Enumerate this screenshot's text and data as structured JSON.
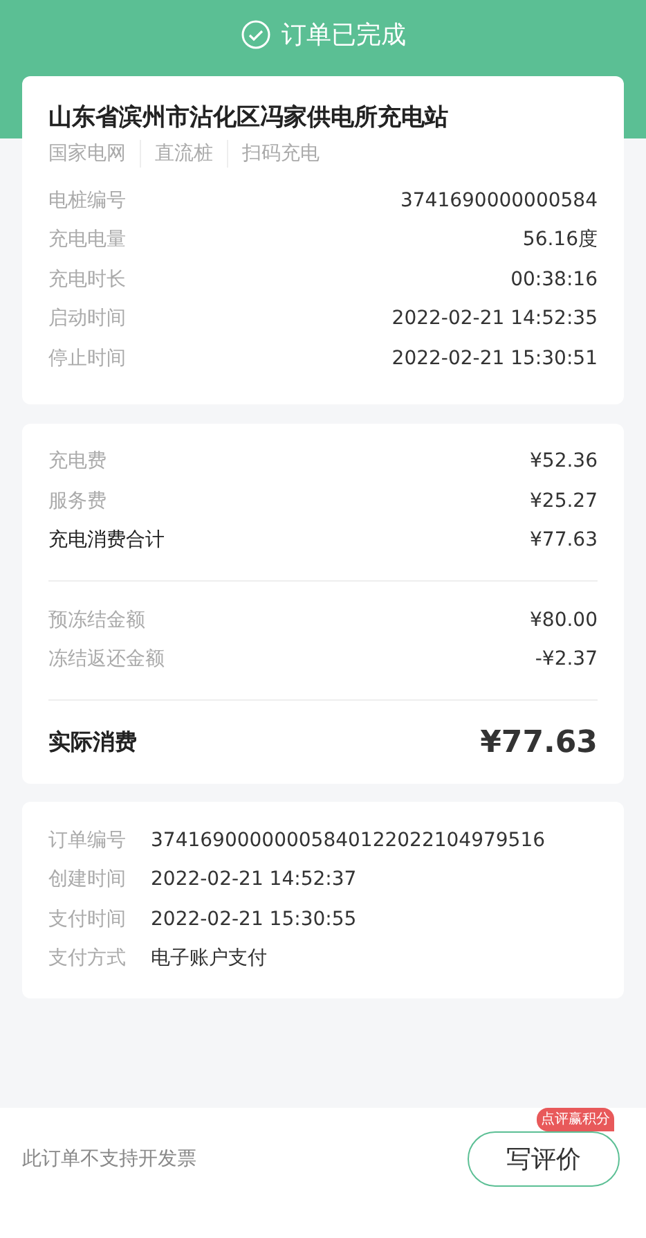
{
  "header": {
    "title": "订单已完成"
  },
  "station": {
    "name": "山东省滨州市沾化区冯家供电所充电站",
    "tags": [
      "国家电网",
      "直流桩",
      "扫码充电"
    ],
    "details": [
      {
        "label": "电桩编号",
        "value": "3741690000000584"
      },
      {
        "label": "充电电量",
        "value": "56.16度"
      },
      {
        "label": "充电时长",
        "value": "00:38:16"
      },
      {
        "label": "启动时间",
        "value": "2022-02-21 14:52:35"
      },
      {
        "label": "停止时间",
        "value": "2022-02-21 15:30:51"
      }
    ]
  },
  "fees": {
    "groups": [
      [
        {
          "kind": "item",
          "label": "充电费",
          "value": "¥52.36"
        },
        {
          "kind": "item",
          "label": "服务费",
          "value": "¥25.27"
        },
        {
          "kind": "subtotal",
          "label": "充电消费合计",
          "value": "¥77.63"
        }
      ],
      [
        {
          "kind": "item",
          "label": "预冻结金额",
          "value": "¥80.00"
        },
        {
          "kind": "item",
          "label": "冻结返还金额",
          "value": "-¥2.37"
        }
      ],
      [
        {
          "kind": "total",
          "label": "实际消费",
          "value": "¥77.63"
        }
      ]
    ]
  },
  "order": [
    {
      "label": "订单编号",
      "value": "37416900000005840122022104979516"
    },
    {
      "label": "创建时间",
      "value": "2022-02-21 14:52:37"
    },
    {
      "label": "支付时间",
      "value": "2022-02-21 15:30:55"
    },
    {
      "label": "支付方式",
      "value": "电子账户支付"
    }
  ],
  "footer": {
    "note": "此订单不支持开发票",
    "button": "写评价",
    "badge": "点评赢积分"
  }
}
